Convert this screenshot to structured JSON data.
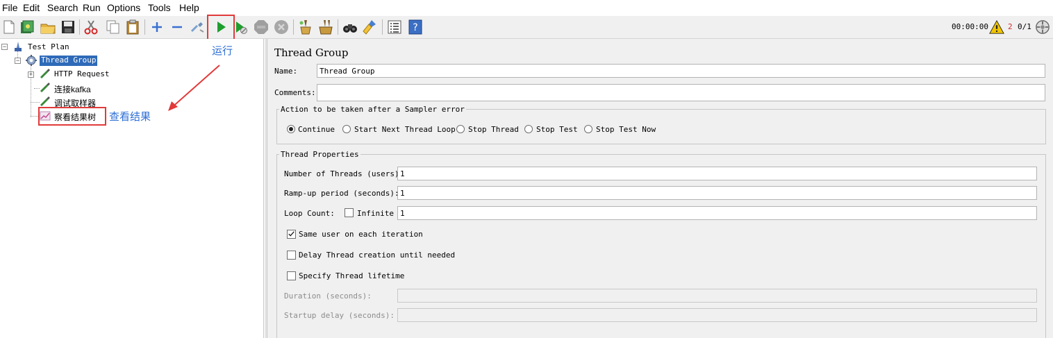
{
  "menu": [
    "File",
    "Edit",
    "Search",
    "Run",
    "Options",
    "Tools",
    "Help"
  ],
  "toolbar": {
    "icons": [
      "new-icon",
      "templates-icon",
      "open-icon",
      "save-icon",
      "cut-icon",
      "copy-icon",
      "paste-icon",
      "expand-icon",
      "collapse-icon",
      "toggle-icon",
      "start-icon",
      "start-no-pauses-icon",
      "stop-icon",
      "shutdown-icon",
      "clear-icon",
      "clear-all-icon",
      "search-icon",
      "reset-search-icon",
      "function-helper-icon",
      "help-icon"
    ],
    "timer": "00:00:00",
    "error_count": "2",
    "threads": "0/1"
  },
  "tree": {
    "test_plan": "Test Plan",
    "thread_group": "Thread Group",
    "http_request": "HTTP Request",
    "kafka": "连接kafka",
    "debug_sampler": "调试取样器",
    "result_tree": "察看结果树"
  },
  "annotations": {
    "run": "运行",
    "view_results": "查看结果"
  },
  "config": {
    "title": "Thread Group",
    "name_label": "Name:",
    "name_value": "Thread Group",
    "comments_label": "Comments:",
    "comments_value": "",
    "error_action_legend": "Action to be taken after a Sampler error",
    "error_actions": [
      "Continue",
      "Start Next Thread Loop",
      "Stop Thread",
      "Stop Test",
      "Stop Test Now"
    ],
    "error_action_selected": "Continue",
    "thread_props_legend": "Thread Properties",
    "threads_label": "Number of Threads (users):",
    "threads_value": "1",
    "rampup_label": "Ramp-up period (seconds):",
    "rampup_value": "1",
    "loop_label": "Loop Count:",
    "infinite_label": "Infinite",
    "loop_value": "1",
    "same_user_label": "Same user on each iteration",
    "delay_label": "Delay Thread creation until needed",
    "lifetime_label": "Specify Thread lifetime",
    "duration_label": "Duration (seconds):",
    "startup_label": "Startup delay (seconds):"
  },
  "colors": {
    "selection": "#2e6ab8",
    "annotation_box": "#e23a3a",
    "annotation_text": "#2d6fd6",
    "run_green": "#1e9e2e"
  }
}
